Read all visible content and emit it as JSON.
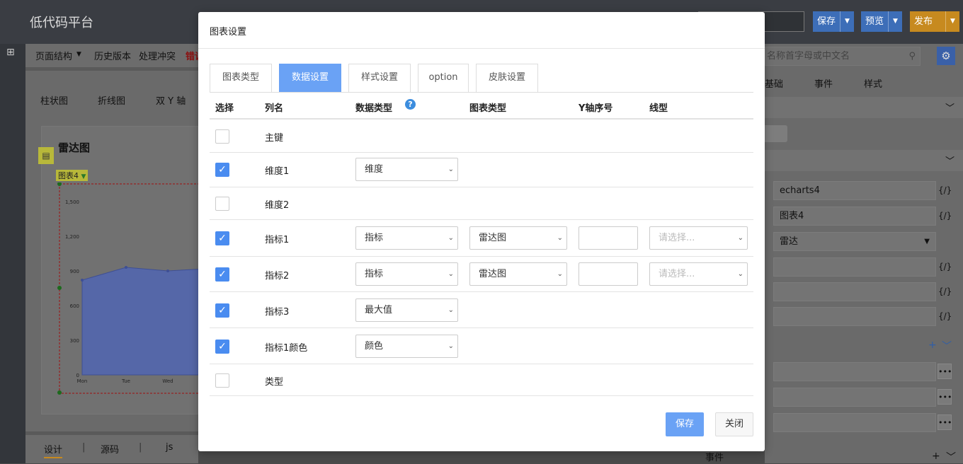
{
  "app": {
    "title": "低代码平台"
  },
  "toolbar": {
    "save": "保存",
    "preview": "预览",
    "publish": "发布"
  },
  "menubar": {
    "page_structure": "页面结构",
    "history": "历史版本",
    "conflicts": "处理冲突",
    "error": "错误"
  },
  "chart_tabs": [
    "柱状图",
    "折线图",
    "双 Y 轴"
  ],
  "canvas": {
    "title": "雷达图",
    "chart_label": "图表4",
    "y_ticks": [
      "1,500",
      "1,200",
      "900",
      "600",
      "300",
      "0"
    ],
    "x_ticks": [
      "Mon",
      "Tue",
      "Wed"
    ],
    "series_values": [
      820,
      930,
      900,
      920
    ]
  },
  "bottom_tabs": {
    "design": "设计",
    "source": "源码",
    "js": "js"
  },
  "right_panel": {
    "search_placeholder": "名称首字母或中文名",
    "tabs": [
      "基础",
      "事件",
      "样式"
    ],
    "fields": [
      "echarts4",
      "图表4",
      "雷达",
      "",
      "",
      ""
    ],
    "event_label": "事件"
  },
  "modal": {
    "title": "图表设置",
    "tabs": [
      "图表类型",
      "数据设置",
      "样式设置",
      "option",
      "皮肤设置"
    ],
    "active_tab": "数据设置",
    "columns": {
      "select": "选择",
      "name": "列名",
      "data_type": "数据类型",
      "chart_type": "图表类型",
      "y_axis": "Y轴序号",
      "line_type": "线型"
    },
    "rows": [
      {
        "name": "主键",
        "checked": false,
        "data_type": "",
        "chart_type": "",
        "y_axis": "",
        "line_type": ""
      },
      {
        "name": "维度1",
        "checked": true,
        "data_type": "维度",
        "chart_type": "",
        "y_axis": "",
        "line_type": ""
      },
      {
        "name": "维度2",
        "checked": false,
        "data_type": "",
        "chart_type": "",
        "y_axis": "",
        "line_type": ""
      },
      {
        "name": "指标1",
        "checked": true,
        "data_type": "指标",
        "chart_type": "雷达图",
        "y_axis": "",
        "line_type": "请选择..."
      },
      {
        "name": "指标2",
        "checked": true,
        "data_type": "指标",
        "chart_type": "雷达图",
        "y_axis": "",
        "line_type": "请选择..."
      },
      {
        "name": "指标3",
        "checked": true,
        "data_type": "最大值",
        "chart_type": "",
        "y_axis": "",
        "line_type": ""
      },
      {
        "name": "指标1颜色",
        "checked": true,
        "data_type": "颜色",
        "chart_type": "",
        "y_axis": "",
        "line_type": ""
      },
      {
        "name": "类型",
        "checked": false,
        "data_type": "",
        "chart_type": "",
        "y_axis": "",
        "line_type": ""
      }
    ],
    "save": "保存",
    "close": "关闭"
  },
  "colors": {
    "accent": "#6aa2f5",
    "checkbox": "#4a8cf0",
    "help": "#3c8dde"
  }
}
